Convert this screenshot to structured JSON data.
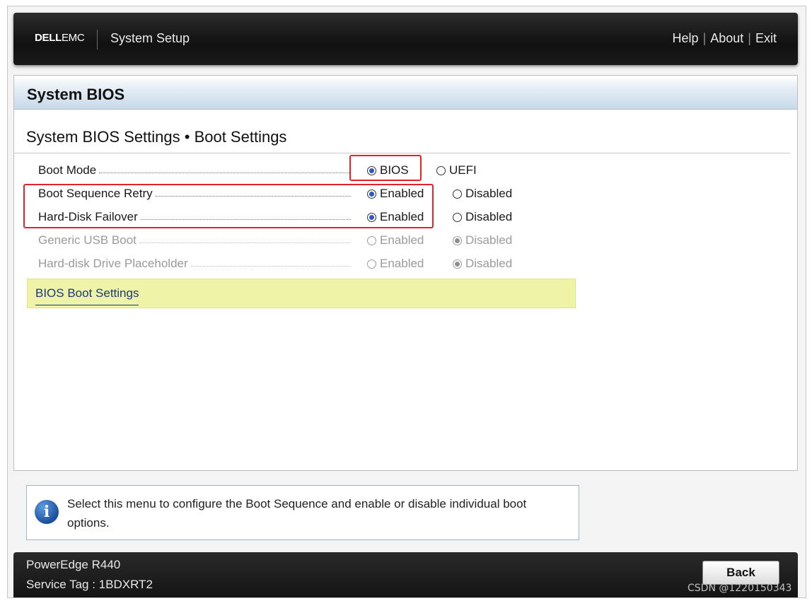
{
  "header": {
    "logo_dell": "DELL",
    "logo_emc": "EMC",
    "title": "System Setup",
    "links": [
      "Help",
      "About",
      "Exit"
    ],
    "separator": "|"
  },
  "panel": {
    "title": "System BIOS",
    "subtitle": "System BIOS Settings • Boot Settings"
  },
  "settings": [
    {
      "label": "Boot Mode",
      "options": [
        "BIOS",
        "UEFI"
      ],
      "selected": 0,
      "disabled": false
    },
    {
      "label": "Boot Sequence Retry",
      "options": [
        "Enabled",
        "Disabled"
      ],
      "selected": 0,
      "disabled": false
    },
    {
      "label": "Hard-Disk Failover",
      "options": [
        "Enabled",
        "Disabled"
      ],
      "selected": 0,
      "disabled": false
    },
    {
      "label": "Generic USB Boot",
      "options": [
        "Enabled",
        "Disabled"
      ],
      "selected": 1,
      "disabled": true
    },
    {
      "label": "Hard-disk Drive Placeholder",
      "options": [
        "Enabled",
        "Disabled"
      ],
      "selected": 1,
      "disabled": true
    }
  ],
  "submenu": {
    "label": "BIOS Boot Settings"
  },
  "help": {
    "icon": "info-icon",
    "icon_glyph": "i",
    "message": "Select this menu to configure the Boot Sequence and enable or disable individual boot options."
  },
  "footer": {
    "model": "PowerEdge R440",
    "service_tag": "Service Tag : 1BDXRT2",
    "back_label": "Back"
  },
  "watermark": "CSDN @1220150343",
  "colors": {
    "highlight_box": "#e0242b",
    "submenu_bg": "#eef3a8",
    "radio_selected": "#2b57c8"
  }
}
